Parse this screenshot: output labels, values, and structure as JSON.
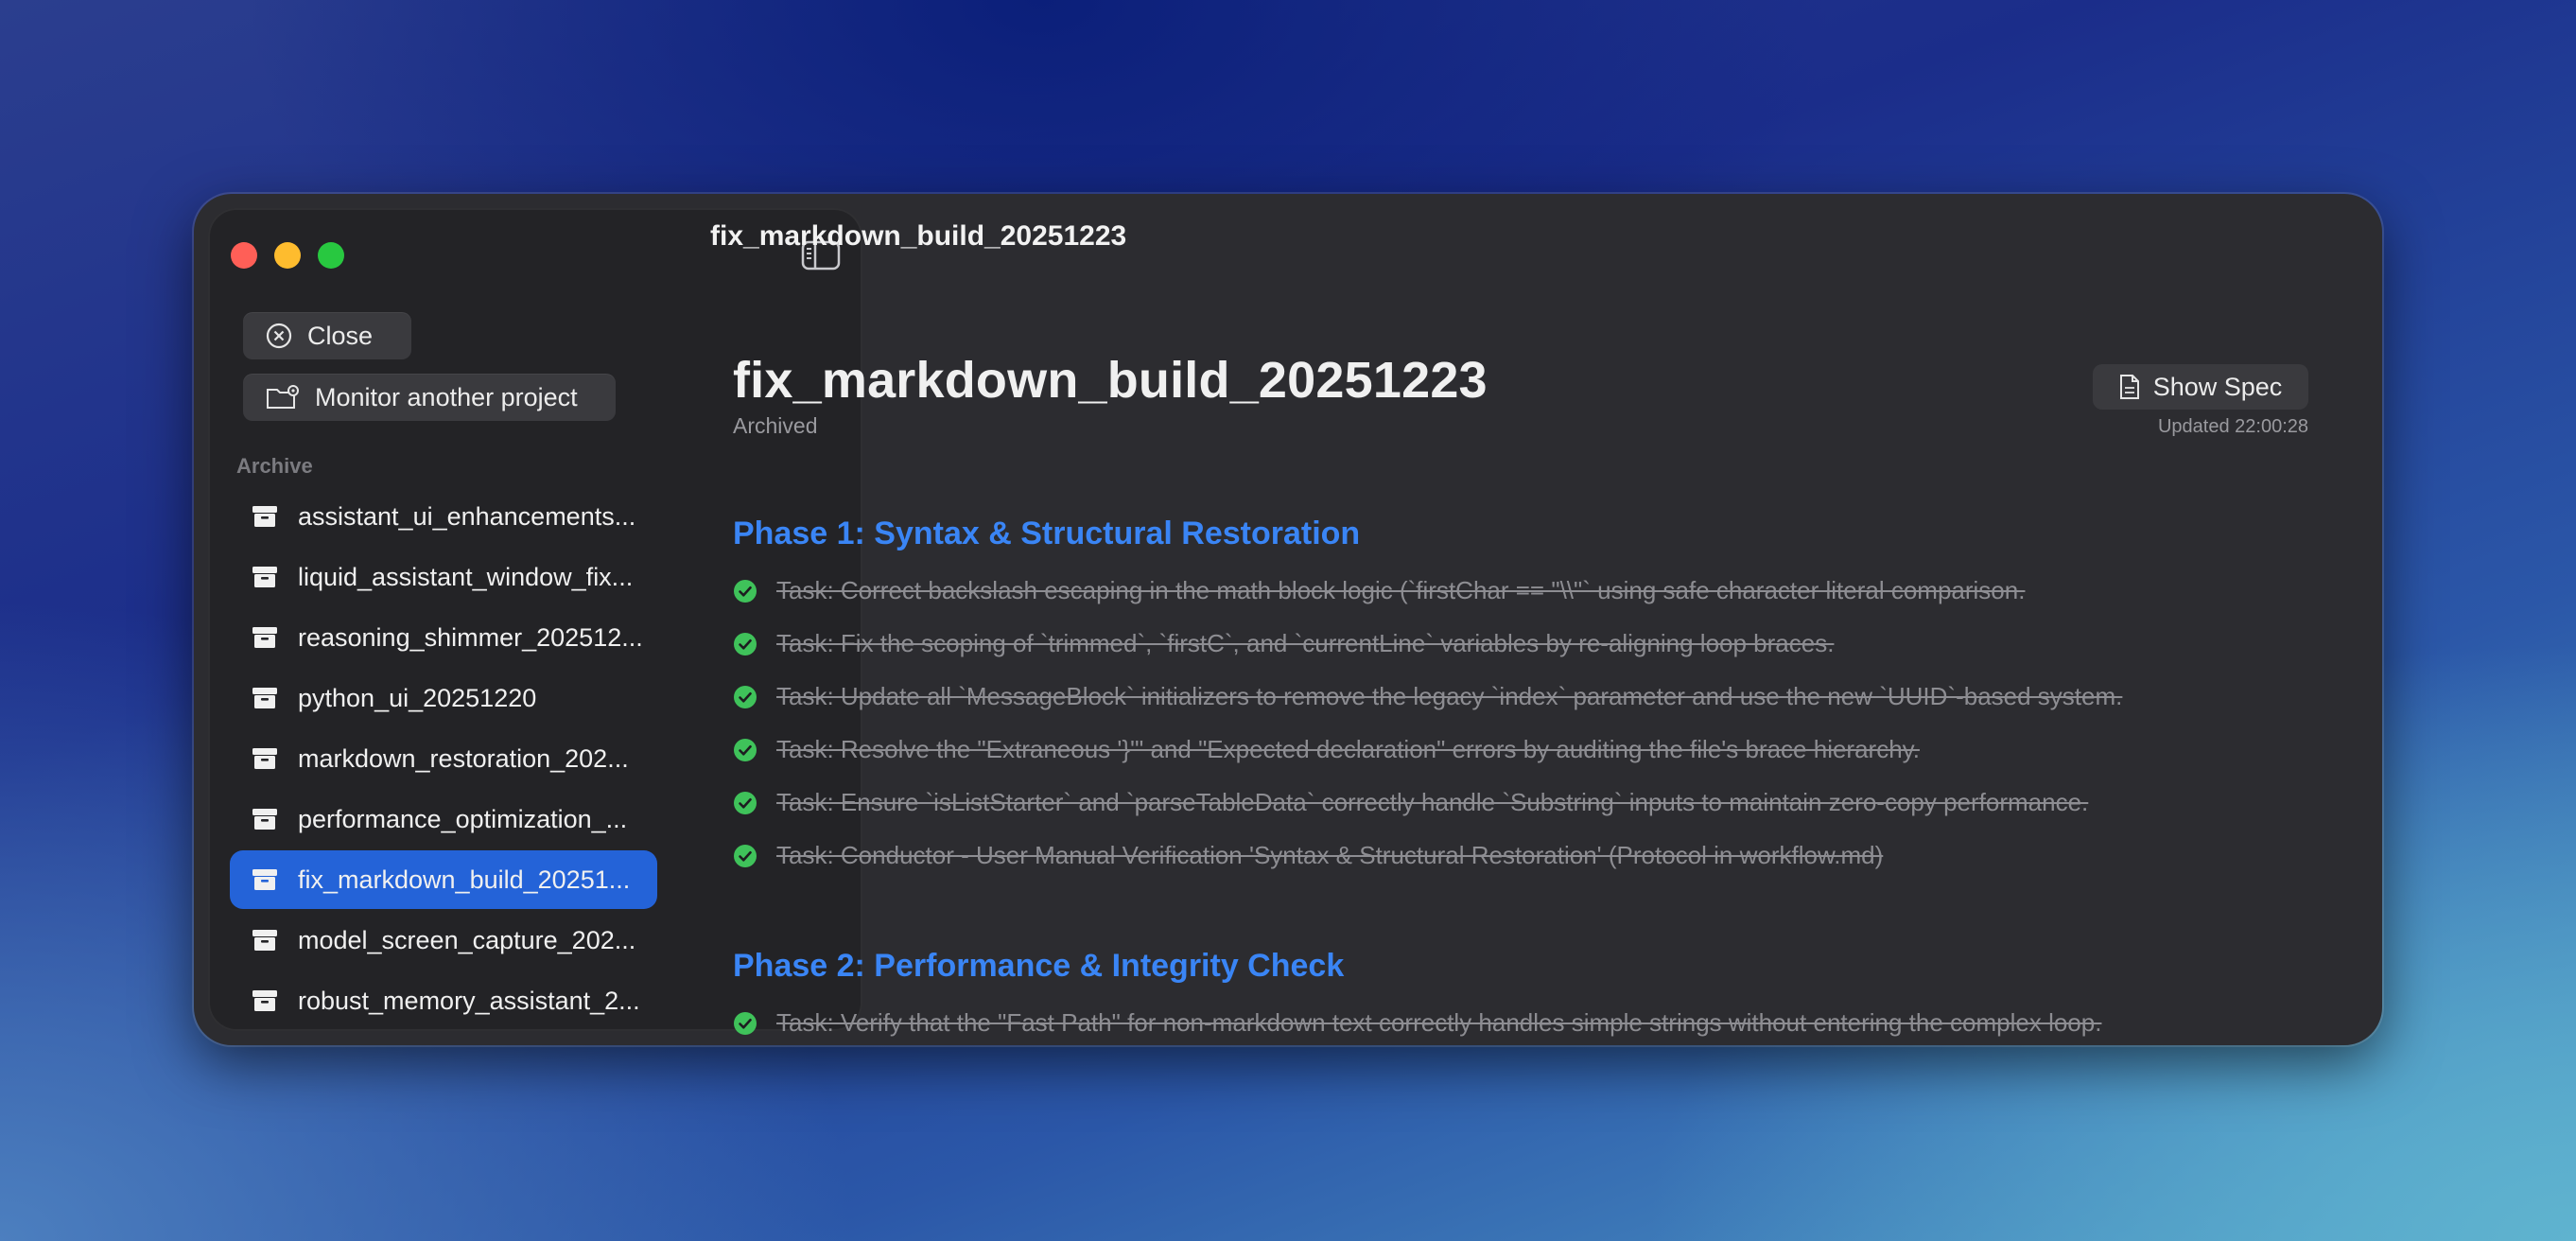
{
  "window": {
    "title": "fix_markdown_build_20251223"
  },
  "sidebar": {
    "close_label": "Close",
    "monitor_label": "Monitor another project",
    "section_label": "Archive",
    "items": [
      {
        "label": "assistant_ui_enhancements..."
      },
      {
        "label": "liquid_assistant_window_fix..."
      },
      {
        "label": "reasoning_shimmer_202512..."
      },
      {
        "label": "python_ui_20251220"
      },
      {
        "label": "markdown_restoration_202..."
      },
      {
        "label": "performance_optimization_..."
      },
      {
        "label": "fix_markdown_build_20251..."
      },
      {
        "label": "model_screen_capture_202..."
      },
      {
        "label": "robust_memory_assistant_2..."
      }
    ],
    "selected_index": 6
  },
  "main": {
    "title": "fix_markdown_build_20251223",
    "status": "Archived",
    "show_spec_label": "Show Spec",
    "updated": "Updated 22:00:28",
    "phases": [
      {
        "title": "Phase 1: Syntax & Structural Restoration",
        "tasks": [
          "Task: Correct backslash escaping in the math block logic (`firstChar == \"\\\\\"` using safe character literal comparison.",
          "Task: Fix the scoping of `trimmed`, `firstC`, and `currentLine` variables by re-aligning loop braces.",
          "Task: Update all `MessageBlock` initializers to remove the legacy `index` parameter and use the new `UUID`-based system.",
          "Task: Resolve the \"Extraneous '}'\" and \"Expected declaration\" errors by auditing the file's brace hierarchy.",
          "Task: Ensure `isListStarter` and `parseTableData` correctly handle `Substring` inputs to maintain zero-copy performance.",
          "Task: Conductor - User Manual Verification 'Syntax & Structural Restoration' (Protocol in workflow.md)"
        ]
      },
      {
        "title": "Phase 2: Performance & Integrity Check",
        "tasks": [
          "Task: Verify that the \"Fast Path\" for non-markdown text correctly handles simple strings without entering the complex loop."
        ]
      }
    ]
  },
  "colors": {
    "accent": "#3a85f5",
    "selection": "#2463d8",
    "check": "#3fc25a"
  },
  "icons": {
    "close": "xmark-circle-icon",
    "monitor": "folder-badge-icon",
    "archive": "archivebox-icon",
    "sidebar_toggle": "sidebar-left-icon",
    "spec": "document-icon",
    "task_done": "checkmark-circle-icon"
  }
}
